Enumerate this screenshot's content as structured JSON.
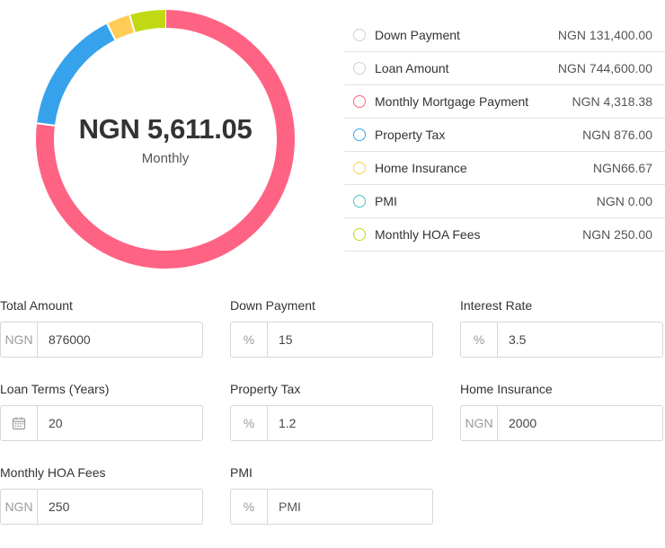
{
  "summary": {
    "total": "NGN 5,611.05",
    "caption": "Monthly"
  },
  "chart_data": {
    "type": "pie",
    "slices": [
      {
        "label": "Monthly Mortgage Payment",
        "value": 4318.38,
        "color": "#ff6384"
      },
      {
        "label": "Property Tax",
        "value": 876.0,
        "color": "#36a2eb"
      },
      {
        "label": "Home Insurance",
        "value": 166.67,
        "color": "#ffcd56"
      },
      {
        "label": "PMI",
        "value": 0.0,
        "color": "#4bc0c0"
      },
      {
        "label": "Monthly HOA Fees",
        "value": 250.0,
        "color": "#c0d914"
      }
    ]
  },
  "legend": {
    "items": [
      {
        "label": "Down Payment",
        "value": "NGN 131,400.00",
        "color": "#d0d0d0"
      },
      {
        "label": "Loan Amount",
        "value": "NGN 744,600.00",
        "color": "#d0d0d0"
      },
      {
        "label": "Monthly Mortgage Payment",
        "value": "NGN 4,318.38",
        "color": "#ff6384"
      },
      {
        "label": "Property Tax",
        "value": "NGN 876.00",
        "color": "#36a2eb"
      },
      {
        "label": "Home Insurance",
        "value": "NGN66.67",
        "color": "#ffcd56"
      },
      {
        "label": "PMI",
        "value": "NGN 0.00",
        "color": "#4bc0c0"
      },
      {
        "label": "Monthly HOA Fees",
        "value": "NGN 250.00",
        "color": "#c0d914"
      }
    ]
  },
  "form": {
    "total_amount": {
      "label": "Total Amount",
      "addon": "NGN",
      "value": "876000"
    },
    "down_payment": {
      "label": "Down Payment",
      "addon": "%",
      "value": "15"
    },
    "interest_rate": {
      "label": "Interest Rate",
      "addon": "%",
      "value": "3.5"
    },
    "loan_terms": {
      "label": "Loan Terms (Years)",
      "addon_icon": "calendar-icon",
      "value": "20"
    },
    "property_tax": {
      "label": "Property Tax",
      "addon": "%",
      "value": "1.2"
    },
    "home_insurance": {
      "label": "Home Insurance",
      "addon": "NGN",
      "value": "2000"
    },
    "hoa_fees": {
      "label": "Monthly HOA Fees",
      "addon": "NGN",
      "value": "250"
    },
    "pmi": {
      "label": "PMI",
      "addon": "%",
      "value": "",
      "placeholder": "PMI"
    }
  }
}
